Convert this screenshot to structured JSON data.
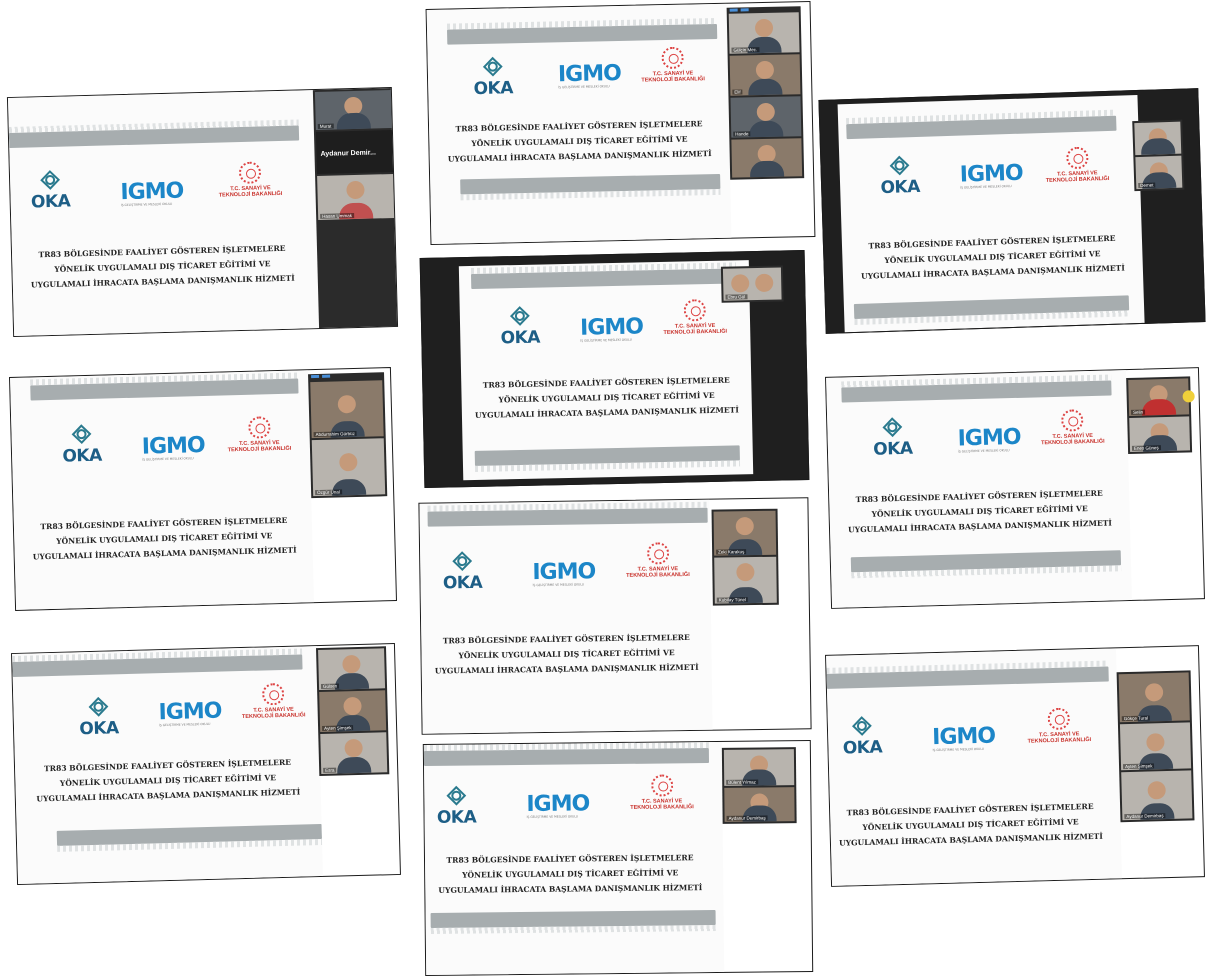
{
  "slide": {
    "title_line1": "TR83 BÖLGESİNDE FAALİYET GÖSTEREN İŞLETMELERE",
    "title_line2": "YÖNELİK UYGULAMALI DIŞ TİCARET EĞİTİMİ VE",
    "title_line3": "UYGULAMALI İHRACATA BAŞLAMA DANIŞMANLIK HİZMETİ",
    "logo_oka": "OKA",
    "logo_oka_sub": "ORTA KARADENİZ KALKINMA AJANSI",
    "logo_igmo": "IGMO",
    "logo_igmo_sub": "İŞ GELİŞTİRME VE MESLEKİ OKULU",
    "logo_tc_line1": "T.C. SANAYİ VE",
    "logo_tc_line2": "TEKNOLOJİ BAKANLIĞI"
  },
  "participants": {
    "p1": "Aydanur Demir...",
    "p2": "Hasan Ummak",
    "p3": "Murat",
    "p4": "Gülçin Mec.",
    "p5": "Elif",
    "p6": "Hande",
    "p7": "Demet",
    "p8": "Ebru Gül",
    "p9": "Abdurrahim Gürbüz",
    "p10": "Özgür Ünal",
    "p11": "Selin",
    "p12": "Enes Güneş",
    "p13": "Zeki Karakuş",
    "p14": "Kubilay Tünel",
    "p15": "Gülsen",
    "p16": "Ayten Şimşek",
    "p17": "Esra",
    "p18": "Bülent Yılmaz",
    "p19": "Aydanur Demirbaş",
    "p20": "Gökçe Tural"
  },
  "colors": {
    "band": "#a7adaf",
    "oka": "#1d5e86",
    "igmo": "#1c86c8",
    "tc": "#c8302a"
  }
}
